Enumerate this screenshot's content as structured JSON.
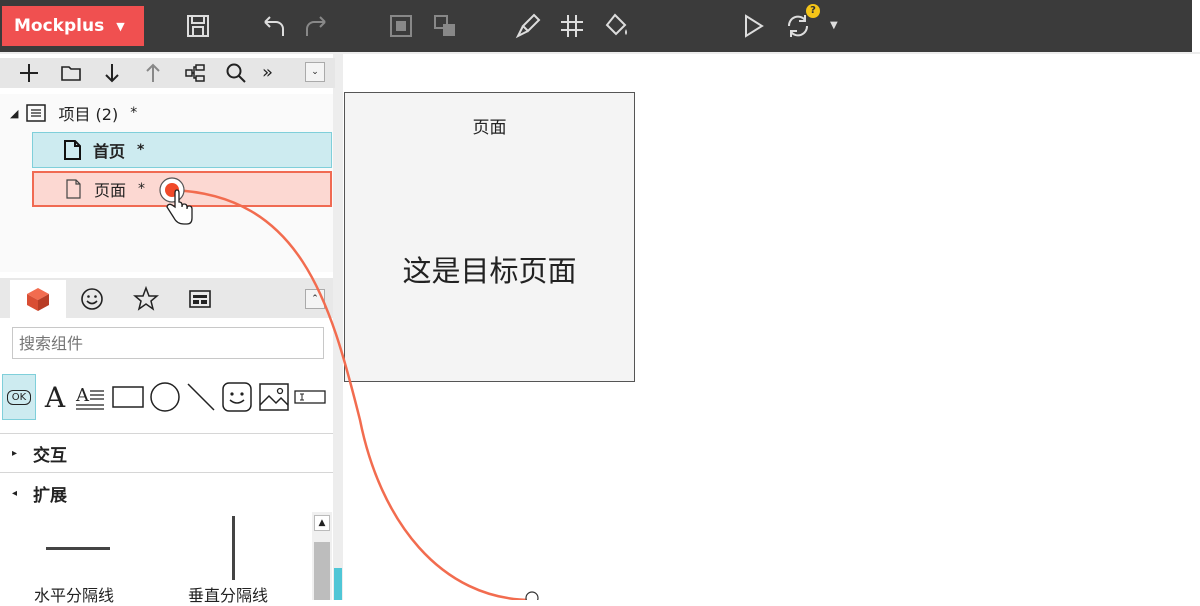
{
  "toolbar": {
    "brand": "Mockplus",
    "icons": [
      "save-icon",
      "undo-icon",
      "redo-icon",
      "group-icon",
      "ungroup-icon",
      "format-brush-icon",
      "grid-icon",
      "fill-icon",
      "preview-play-icon",
      "sync-icon"
    ],
    "sync_badge": "?"
  },
  "project_toolbar": {
    "icons": [
      "add-icon",
      "folder-icon",
      "move-down-icon",
      "move-up-icon",
      "tree-icon",
      "search-icon",
      "more-icon",
      "collapse-icon"
    ],
    "more_label": "»"
  },
  "tree": {
    "root": {
      "label": "项目 (2)",
      "marker": "*"
    },
    "items": [
      {
        "label": "首页",
        "marker": "*"
      },
      {
        "label": "页面",
        "marker": "*"
      }
    ]
  },
  "components": {
    "tabs": [
      "box-icon",
      "emoji-icon",
      "star-icon",
      "template-icon"
    ],
    "search_placeholder": "搜索组件",
    "ok_label": "OK",
    "sections": [
      {
        "label": "交互",
        "arrow": "▸"
      },
      {
        "label": "扩展",
        "arrow": "◂"
      }
    ],
    "extensions": [
      {
        "label": "水平分隔线"
      },
      {
        "label": "垂直分隔线"
      }
    ]
  },
  "canvas": {
    "page_title": "页面",
    "page_body": "这是目标页面"
  },
  "colors": {
    "brand": "#f05050",
    "link_curve": "#f26c4f",
    "selected_home": "#cdebf0",
    "selected_page": "#fcd8d2"
  }
}
